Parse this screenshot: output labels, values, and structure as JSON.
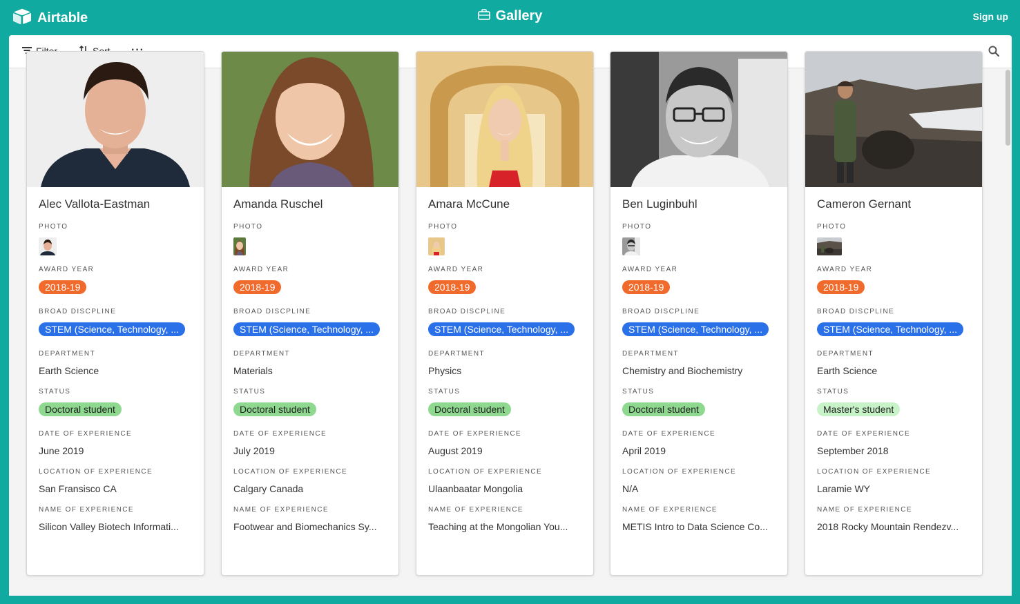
{
  "app": {
    "name": "Airtable",
    "view_title": "Gallery",
    "signup_label": "Sign up"
  },
  "toolbar": {
    "filter_label": "Filter",
    "sort_label": "Sort",
    "more_label": "···"
  },
  "labels": {
    "photo": "PHOTO",
    "award_year": "AWARD YEAR",
    "discipline": "BROAD DISCPLINE",
    "department": "DEPARTMENT",
    "status": "STATUS",
    "date": "DATE OF EXPERIENCE",
    "location": "LOCATION OF EXPERIENCE",
    "experience": "NAME OF EXPERIENCE"
  },
  "colors": {
    "brand": "#10aaa0",
    "award_pill": "#f06a2b",
    "discipline_pill": "#2a70e8",
    "doctoral_pill": "#8ed98f",
    "masters_pill": "#c8f3c8"
  },
  "cards": [
    {
      "name": "Alec Vallota-Eastman",
      "award_year": "2018-19",
      "discipline": "STEM (Science, Technology, ...",
      "department": "Earth Science",
      "status": "Doctoral student",
      "date": "June 2019",
      "location": "San Fransisco CA",
      "experience": "Silicon Valley Biotech Informati..."
    },
    {
      "name": "Amanda Ruschel",
      "award_year": "2018-19",
      "discipline": "STEM (Science, Technology, ...",
      "department": "Materials",
      "status": "Doctoral student",
      "date": "July 2019",
      "location": "Calgary Canada",
      "experience": "Footwear and Biomechanics Sy..."
    },
    {
      "name": "Amara McCune",
      "award_year": "2018-19",
      "discipline": "STEM (Science, Technology, ...",
      "department": "Physics",
      "status": "Doctoral student",
      "date": "August 2019",
      "location": "Ulaanbaatar Mongolia",
      "experience": "Teaching at the Mongolian You..."
    },
    {
      "name": "Ben Luginbuhl",
      "award_year": "2018-19",
      "discipline": "STEM (Science, Technology, ...",
      "department": "Chemistry and Biochemistry",
      "status": "Doctoral student",
      "date": "April 2019",
      "location": "N/A",
      "experience": "METIS Intro to Data Science Co..."
    },
    {
      "name": "Cameron Gernant",
      "award_year": "2018-19",
      "discipline": "STEM (Science, Technology, ...",
      "department": "Earth Science",
      "status": "Master's student",
      "date": "September 2018",
      "location": "Laramie WY",
      "experience": "2018 Rocky Mountain Rendezv..."
    }
  ]
}
